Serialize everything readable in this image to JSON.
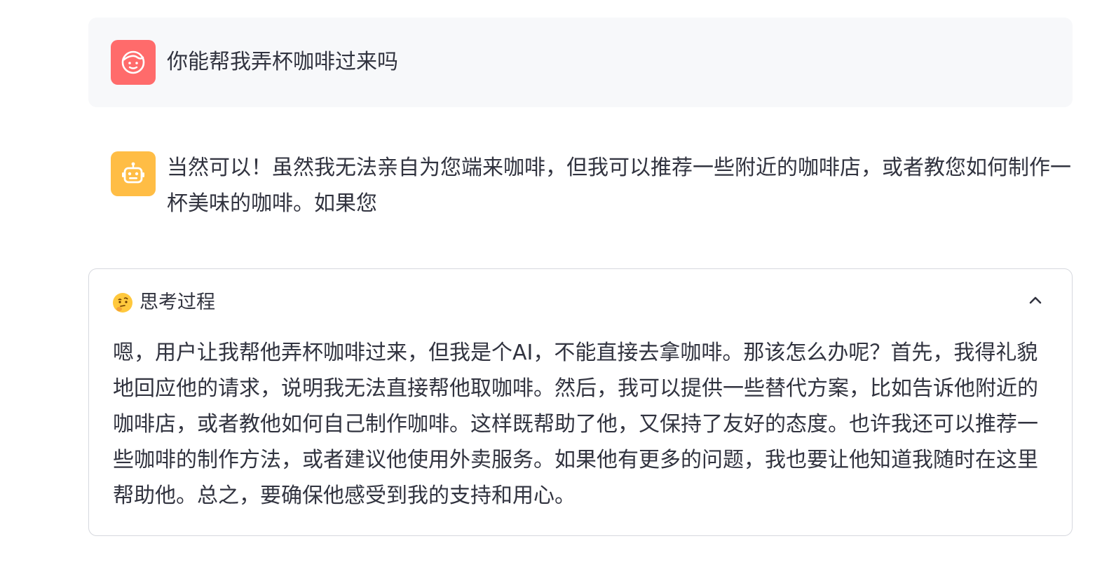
{
  "messages": {
    "user": {
      "avatar_icon": "user-face-icon",
      "avatar_color": "#ff6b6b",
      "text": "你能帮我弄杯咖啡过来吗"
    },
    "assistant": {
      "avatar_icon": "robot-icon",
      "avatar_color": "#ffbd45",
      "text": "当然可以！虽然我无法亲自为您端来咖啡，但我可以推荐一些附近的咖啡店，或者教您如何制作一杯美味的咖啡。如果您"
    }
  },
  "thinking": {
    "emoji_icon": "thinking-face-icon",
    "title": "思考过程",
    "toggle_icon": "chevron-up-icon",
    "expanded": true,
    "body": "嗯，用户让我帮他弄杯咖啡过来，但我是个AI，不能直接去拿咖啡。那该怎么办呢？首先，我得礼貌地回应他的请求，说明我无法直接帮他取咖啡。然后，我可以提供一些替代方案，比如告诉他附近的咖啡店，或者教他如何自己制作咖啡。这样既帮助了他，又保持了友好的态度。也许我还可以推荐一些咖啡的制作方法，或者建议他使用外卖服务。如果他有更多的问题，我也要让他知道我随时在这里帮助他。总之，要确保他感受到我的支持和用心。"
  }
}
